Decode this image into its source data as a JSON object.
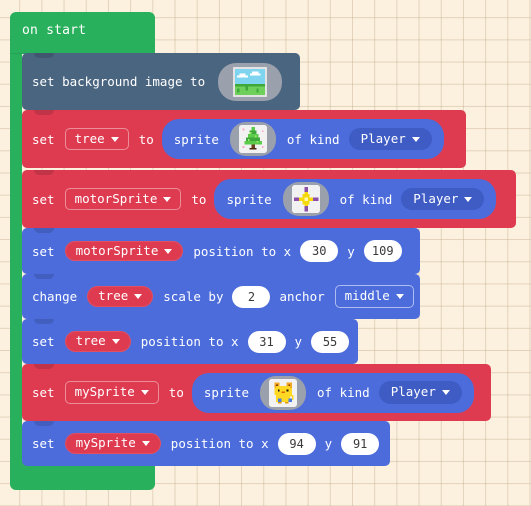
{
  "canvas": {
    "background_color": "#FBF1DE",
    "grid_line_color": "#BEA587",
    "grid_size": 22
  },
  "palette": {
    "event_green": "#29B05C",
    "scene_slate": "#4A6580",
    "variables_red": "#DE3B51",
    "sprites_blue": "#4C6CDB",
    "field_white": "#FFFFFF"
  },
  "event_block": {
    "label": "on start"
  },
  "blocks": [
    {
      "id": "set-background-image",
      "category": "scene",
      "color": "#4A6580",
      "parts": [
        {
          "type": "label",
          "text": "set background image to"
        },
        {
          "type": "image_field",
          "name": "background-image-thumbnail"
        }
      ]
    },
    {
      "id": "set-tree-to-sprite",
      "category": "variables",
      "color": "#DE3B51",
      "parts": [
        {
          "type": "label",
          "text": "set"
        },
        {
          "type": "dropdown_outline",
          "value": "tree"
        },
        {
          "type": "label",
          "text": "to"
        },
        {
          "type": "reporter",
          "label": "sprite",
          "image": "tree-sprite-thumbnail",
          "tail_label": "of kind",
          "kind": "Player"
        }
      ]
    },
    {
      "id": "set-motorsprite-to-sprite",
      "category": "variables",
      "color": "#DE3B51",
      "parts": [
        {
          "type": "label",
          "text": "set"
        },
        {
          "type": "dropdown_outline",
          "value": "motorSprite"
        },
        {
          "type": "label",
          "text": "to"
        },
        {
          "type": "reporter",
          "label": "sprite",
          "image": "star-sprite-thumbnail",
          "tail_label": "of kind",
          "kind": "Player"
        }
      ]
    },
    {
      "id": "set-motorsprite-position",
      "category": "sprites",
      "color": "#4C6CDB",
      "parts": [
        {
          "type": "label",
          "text": "set"
        },
        {
          "type": "dropdown_pill",
          "value": "motorSprite"
        },
        {
          "type": "label",
          "text": "position to x"
        },
        {
          "type": "number",
          "value": "30"
        },
        {
          "type": "label",
          "text": "y"
        },
        {
          "type": "number",
          "value": "109"
        }
      ]
    },
    {
      "id": "change-tree-scale",
      "category": "sprites",
      "color": "#4C6CDB",
      "parts": [
        {
          "type": "label",
          "text": "change"
        },
        {
          "type": "dropdown_pill",
          "value": "tree"
        },
        {
          "type": "label",
          "text": "scale by"
        },
        {
          "type": "number",
          "value": "2"
        },
        {
          "type": "label",
          "text": "anchor"
        },
        {
          "type": "dropdown_blueoutline",
          "value": "middle"
        }
      ]
    },
    {
      "id": "set-tree-position",
      "category": "sprites",
      "color": "#4C6CDB",
      "parts": [
        {
          "type": "label",
          "text": "set"
        },
        {
          "type": "dropdown_pill",
          "value": "tree"
        },
        {
          "type": "label",
          "text": "position to x"
        },
        {
          "type": "number",
          "value": "31"
        },
        {
          "type": "label",
          "text": "y"
        },
        {
          "type": "number",
          "value": "55"
        }
      ]
    },
    {
      "id": "set-mysprite-to-sprite",
      "category": "variables",
      "color": "#DE3B51",
      "parts": [
        {
          "type": "label",
          "text": "set"
        },
        {
          "type": "dropdown_outline",
          "value": "mySprite"
        },
        {
          "type": "label",
          "text": "to"
        },
        {
          "type": "reporter",
          "label": "sprite",
          "image": "creature-sprite-thumbnail",
          "tail_label": "of kind",
          "kind": "Player"
        }
      ]
    },
    {
      "id": "set-mysprite-position",
      "category": "sprites",
      "color": "#4C6CDB",
      "parts": [
        {
          "type": "label",
          "text": "set"
        },
        {
          "type": "dropdown_pill",
          "value": "mySprite"
        },
        {
          "type": "label",
          "text": "position to x"
        },
        {
          "type": "number",
          "value": "94"
        },
        {
          "type": "label",
          "text": "y"
        },
        {
          "type": "number",
          "value": "91"
        }
      ]
    }
  ],
  "text": {
    "on_start": "on start",
    "set": "set",
    "change": "change",
    "to": "to",
    "background_image_to": "set background image to",
    "sprite": "sprite",
    "of_kind": "of kind",
    "player": "Player",
    "position_to_x": "position to x",
    "y": "y",
    "scale_by": "scale by",
    "anchor": "anchor",
    "middle": "middle",
    "tree": "tree",
    "motorSprite": "motorSprite",
    "mySprite": "mySprite",
    "num_30": "30",
    "num_109": "109",
    "num_2": "2",
    "num_31": "31",
    "num_55": "55",
    "num_94": "94",
    "num_91": "91"
  }
}
